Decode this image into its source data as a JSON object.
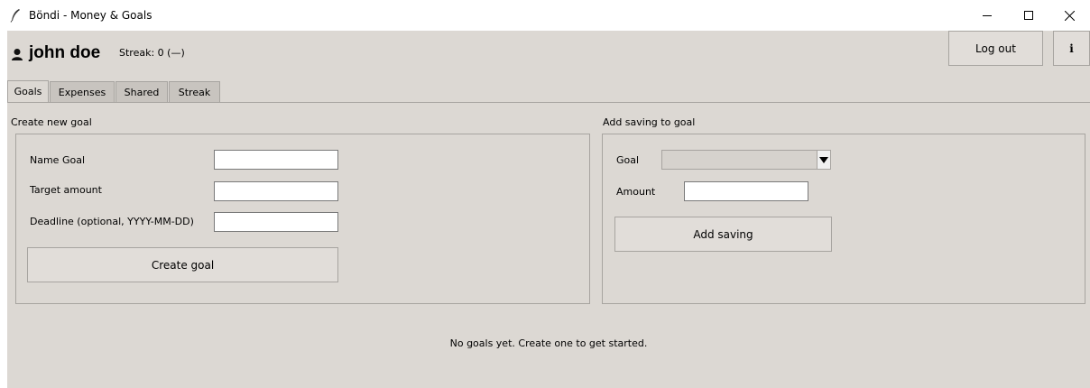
{
  "window": {
    "title": "Böndi - Money & Goals"
  },
  "header": {
    "user_name": "john doe",
    "streak_text": "Streak: 0 (—)",
    "logout_label": "Log out",
    "info_label": "i"
  },
  "tabs": [
    {
      "label": "Goals",
      "active": true
    },
    {
      "label": "Expenses",
      "active": false
    },
    {
      "label": "Shared",
      "active": false
    },
    {
      "label": "Streak",
      "active": false
    }
  ],
  "create_goal": {
    "section_title": "Create new goal",
    "name_label": "Name Goal",
    "name_value": "",
    "target_label": "Target amount",
    "target_value": "",
    "deadline_label": "Deadline (optional, YYYY-MM-DD)",
    "deadline_value": "",
    "submit_label": "Create goal"
  },
  "add_saving": {
    "section_title": "Add saving to goal",
    "goal_label": "Goal",
    "goal_selected": "",
    "amount_label": "Amount",
    "amount_value": "",
    "submit_label": "Add saving"
  },
  "empty_state": {
    "message": "No goals yet. Create one to get started."
  },
  "icons": {
    "app": "feather-icon",
    "user": "user-icon",
    "minimize": "minimize-icon",
    "maximize": "maximize-icon",
    "close": "close-icon",
    "dropdown": "triangle-down-icon"
  }
}
